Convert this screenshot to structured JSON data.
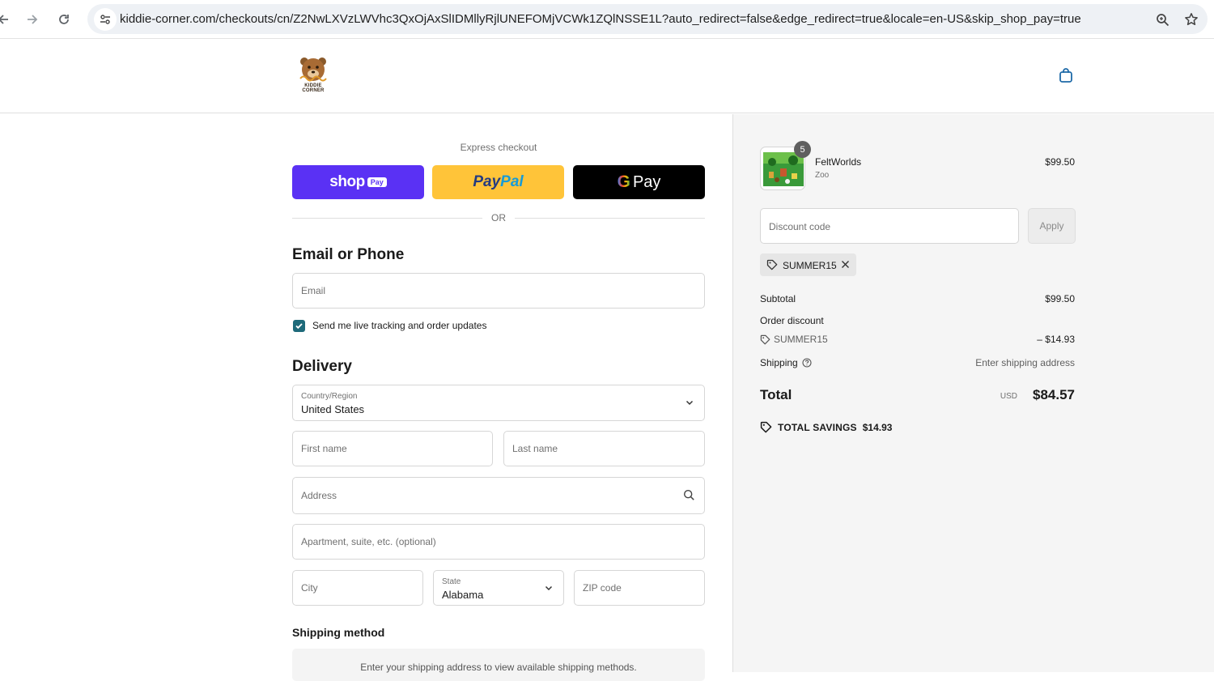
{
  "browser": {
    "url": "kiddie-corner.com/checkouts/cn/Z2NwLXVzLWVhc3QxOjAxSlIDMllyRjlUNEFOMjVCWk1ZQlNSSE1L?auto_redirect=false&edge_redirect=true&locale=en-US&skip_shop_pay=true",
    "icons": [
      "back-icon",
      "forward-icon",
      "reload-icon",
      "site-info-icon",
      "zoom-icon",
      "bookmark-star-icon"
    ]
  },
  "store": {
    "logo_text": "KIDDIE CORNER",
    "cart_icon": "shopping-bag-icon"
  },
  "express": {
    "label": "Express checkout",
    "shop_pay": {
      "word": "shop",
      "pill": "Pay"
    },
    "paypal": {
      "part1": "Pay",
      "part2": "Pal"
    },
    "gpay": {
      "g": "G",
      "word": "Pay"
    },
    "or_text": "OR"
  },
  "contact": {
    "title": "Email or Phone",
    "email_placeholder": "Email",
    "updates_label": "Send me live tracking and order updates",
    "updates_checked": true
  },
  "delivery": {
    "title": "Delivery",
    "country_label": "Country/Region",
    "country_value": "United States",
    "first_name_placeholder": "First name",
    "last_name_placeholder": "Last name",
    "address_placeholder": "Address",
    "apartment_placeholder": "Apartment, suite, etc. (optional)",
    "city_placeholder": "City",
    "state_label": "State",
    "state_value": "Alabama",
    "zip_placeholder": "ZIP code"
  },
  "shipping_method": {
    "title": "Shipping method",
    "message": "Enter your shipping address to view available shipping methods."
  },
  "summary": {
    "item": {
      "name": "FeltWorlds",
      "variant": "Zoo",
      "price": "$99.50",
      "quantity": "5"
    },
    "discount_placeholder": "Discount code",
    "apply_label": "Apply",
    "applied_code": "SUMMER15",
    "subtotal_label": "Subtotal",
    "subtotal_value": "$99.50",
    "order_discount_label": "Order discount",
    "order_discount_code": "SUMMER15",
    "order_discount_value": "– $14.93",
    "shipping_label": "Shipping",
    "shipping_value": "Enter shipping address",
    "total_label": "Total",
    "total_currency": "USD",
    "total_value": "$84.57",
    "savings_label": "TOTAL SAVINGS",
    "savings_value": "$14.93"
  },
  "colors": {
    "shop_pay": "#5a31f4",
    "paypal": "#ffc439",
    "gpay": "#000000",
    "checkbox": "#1e6a7a",
    "summary_bg": "#f5f5f5"
  }
}
